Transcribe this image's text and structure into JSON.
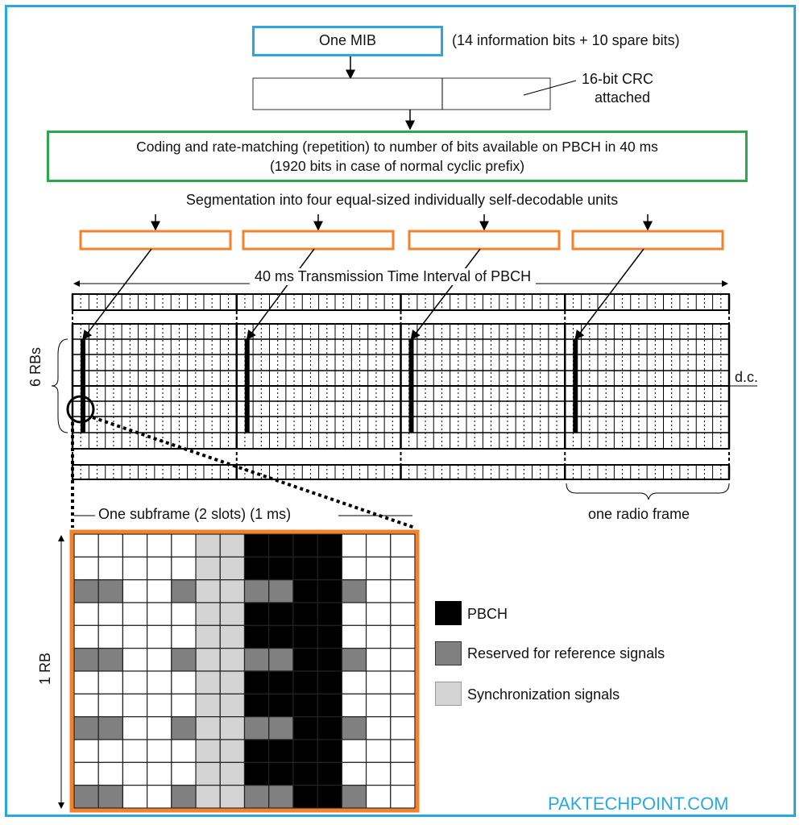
{
  "mib": {
    "label": "One MIB",
    "note": "(14 information bits + 10 spare bits)"
  },
  "crc": {
    "label": "16-bit CRC\nattached",
    "line1": "16-bit CRC",
    "line2": "attached"
  },
  "coding": {
    "line1": "Coding and rate-matching (repetition) to number of bits available on PBCH in 40 ms",
    "line2": "(1920 bits in case of normal cyclic prefix)"
  },
  "segmentation": "Segmentation into four equal-sized individually self-decodable units",
  "tti_label": "40 ms Transmission Time Interval of PBCH",
  "rbs_label": "6 RBs",
  "dc_label": "d.c.",
  "radio_frame_label": "one radio frame",
  "subframe_label": "One subframe (2 slots) (1 ms)",
  "rb_label": "1 RB",
  "legend": [
    {
      "label": "PBCH",
      "color": "#000000"
    },
    {
      "label": "Reserved for reference signals",
      "color": "#808080"
    },
    {
      "label": "Synchronization signals",
      "color": "#d4d4d4"
    }
  ],
  "watermark": "PAKTECHPOINT.COM",
  "colors": {
    "border": "#29a8e0",
    "mib_box": "#29a8e0",
    "coding_box": "#2aa84a",
    "segments": "#f5822a",
    "watermark": "#29a8e0"
  },
  "subframe_grid": {
    "columns": 14,
    "rows": 12,
    "sync_columns": [
      5,
      6
    ],
    "pbch_columns": [
      7,
      8,
      9,
      10
    ],
    "reference_rows": [
      2,
      5,
      8,
      11
    ],
    "reference_columns": [
      0,
      1,
      4,
      7,
      8,
      11
    ]
  }
}
